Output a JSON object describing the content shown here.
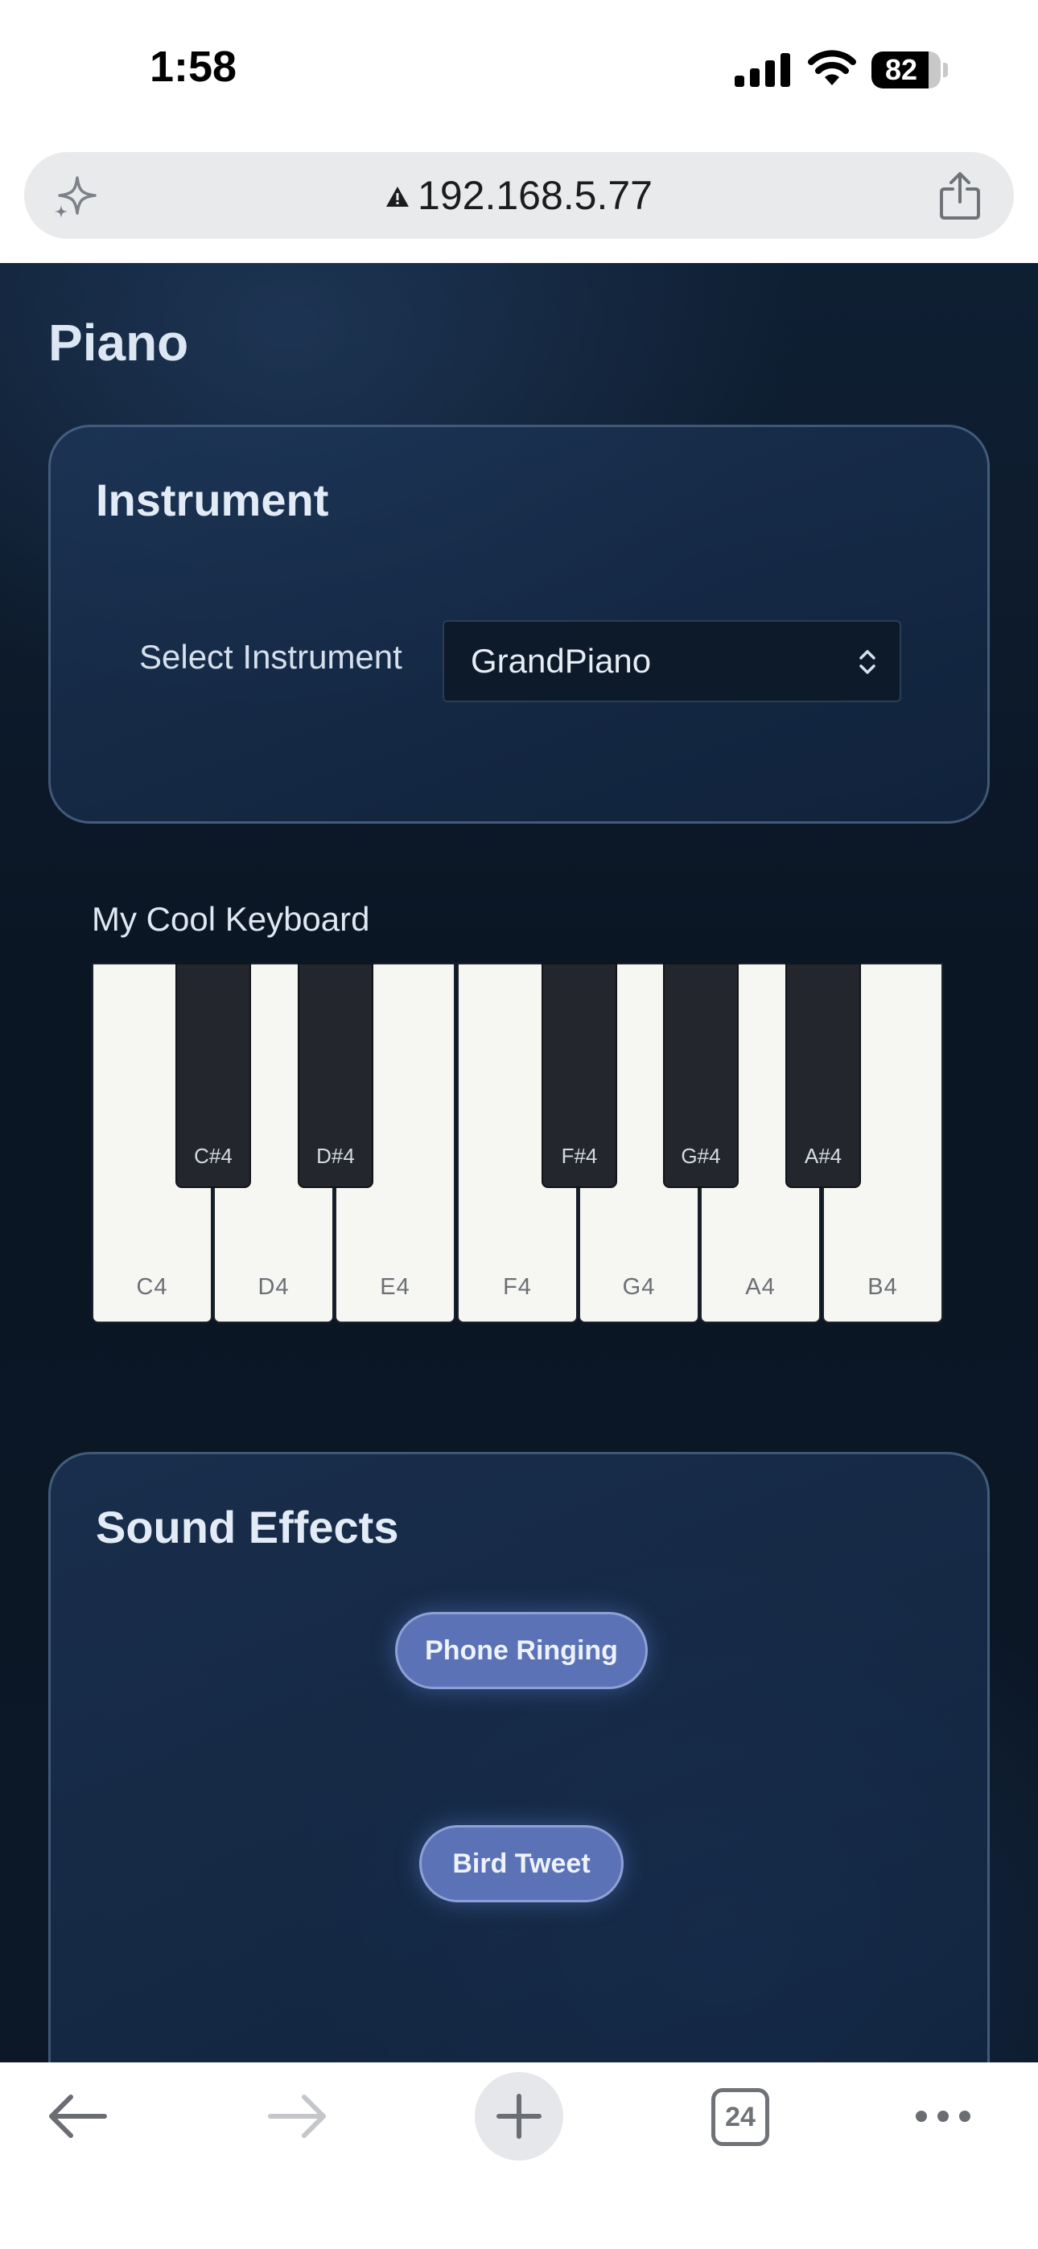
{
  "status_bar": {
    "time": "1:58",
    "battery_percent": 82
  },
  "browser": {
    "url": "192.168.5.77",
    "tab_count": "24"
  },
  "page": {
    "title": "Piano",
    "instrument_card": {
      "title": "Instrument",
      "select_label": "Select Instrument",
      "selected_instrument": "GrandPiano"
    },
    "keyboard": {
      "title": "My Cool Keyboard",
      "white_keys": [
        "C4",
        "D4",
        "E4",
        "F4",
        "G4",
        "A4",
        "B4"
      ],
      "black_keys": [
        "C#4",
        "D#4",
        "F#4",
        "G#4",
        "A#4"
      ]
    },
    "effects_card": {
      "title": "Sound Effects",
      "buttons": [
        "Phone Ringing",
        "Bird Tweet"
      ]
    }
  },
  "colors": {
    "page_background": "#0b1624",
    "accent_button": "#5b72b6",
    "white_key": "#f6f6f3",
    "black_key": "#23262d"
  }
}
